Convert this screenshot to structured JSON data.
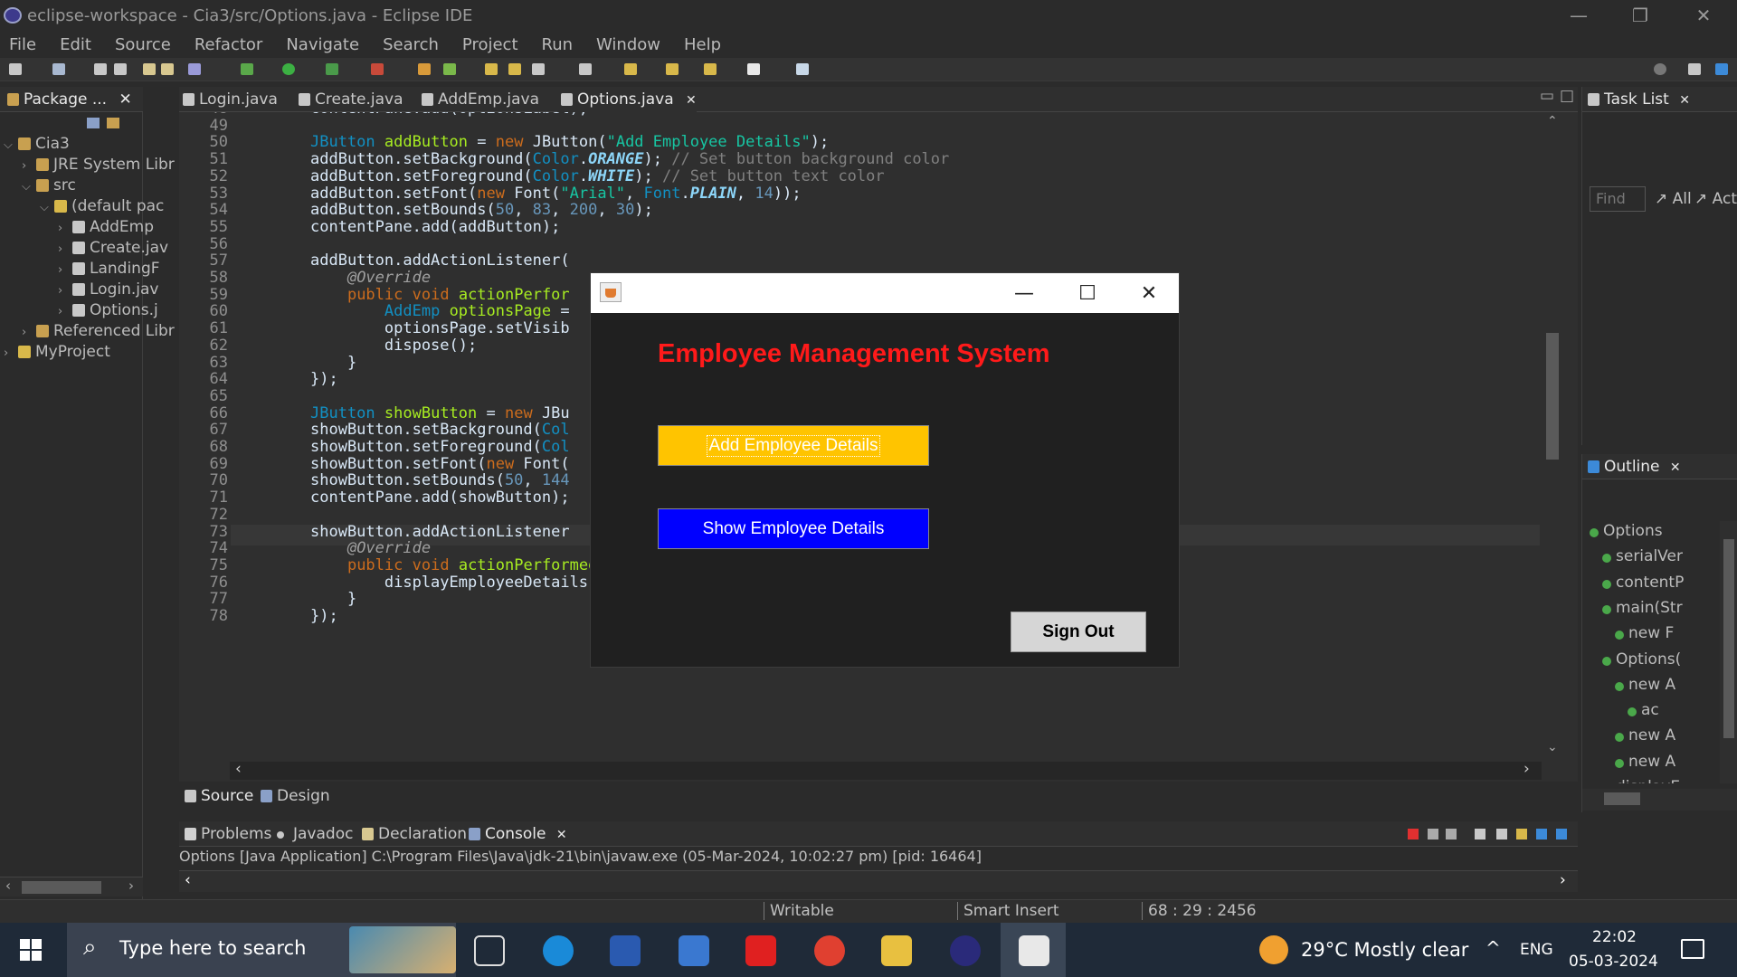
{
  "window": {
    "title": "eclipse-workspace - Cia3/src/Options.java - Eclipse IDE",
    "controls": [
      "—",
      "❐",
      "✕"
    ]
  },
  "menu": [
    "File",
    "Edit",
    "Source",
    "Refactor",
    "Navigate",
    "Search",
    "Project",
    "Run",
    "Window",
    "Help"
  ],
  "package_explorer": {
    "tab_label": "Package ...",
    "rows": [
      {
        "label": "Cia3",
        "arrow": "⌵",
        "indent": 0
      },
      {
        "label": "JRE System Libr",
        "arrow": "›",
        "indent": 1
      },
      {
        "label": "src",
        "arrow": "⌵",
        "indent": 1
      },
      {
        "label": "(default pac",
        "arrow": "⌵",
        "indent": 2
      },
      {
        "label": "AddEmp",
        "arrow": "›",
        "indent": 3
      },
      {
        "label": "Create.jav",
        "arrow": "›",
        "indent": 3
      },
      {
        "label": "LandingF",
        "arrow": "›",
        "indent": 3
      },
      {
        "label": "Login.jav",
        "arrow": "›",
        "indent": 3
      },
      {
        "label": "Options.j",
        "arrow": "›",
        "indent": 3
      },
      {
        "label": "Referenced Libr",
        "arrow": "›",
        "indent": 1
      },
      {
        "label": "MyProject",
        "arrow": "›",
        "indent": 0
      }
    ]
  },
  "editor": {
    "tabs": [
      "Login.java",
      "Create.java",
      "AddEmp.java",
      "Options.java"
    ],
    "active_tab": "Options.java",
    "bottom_tabs": [
      "Source",
      "Design"
    ],
    "lines": [
      {
        "n": "48",
        "html": "contentPane.add(optionsLabel);"
      },
      {
        "n": "49",
        "html": ""
      },
      {
        "n": "50",
        "html": "<span class='ty'>JButton</span> <span class='fn'>addButton</span> = <span class='kw'>new</span> JButton(<span class='st'>\"Add Employee Details\"</span>);"
      },
      {
        "n": "51",
        "html": "addButton.setBackground(<span class='ty'>Color</span>.<span class='sfld'>ORANGE</span>); <span class='cm'>// Set button background color</span>"
      },
      {
        "n": "52",
        "html": "addButton.setForeground(<span class='ty'>Color</span>.<span class='sfld'>WHITE</span>); <span class='cm'>// Set button text color</span>"
      },
      {
        "n": "53",
        "html": "addButton.setFont(<span class='kw'>new</span> Font(<span class='st'>\"Arial\"</span>, <span class='ty'>Font</span>.<span class='sfld'>PLAIN</span>, <span class='nm'>14</span>));"
      },
      {
        "n": "54",
        "html": "addButton.setBounds(<span class='nm'>50</span>, <span class='nm'>83</span>, <span class='nm'>200</span>, <span class='nm'>30</span>);"
      },
      {
        "n": "55",
        "html": "contentPane.add(addButton);"
      },
      {
        "n": "56",
        "html": ""
      },
      {
        "n": "57",
        "html": "addButton.addActionListener("
      },
      {
        "n": "58",
        "html": "    <span class='an'>@Override</span>"
      },
      {
        "n": "59",
        "html": "    <span class='kw'>public</span> <span class='kw'>void</span> <span class='fn'>actionPerfor</span>"
      },
      {
        "n": "60",
        "html": "        <span class='ty'>AddEmp</span> <span class='fn'>optionsPage</span> ="
      },
      {
        "n": "61",
        "html": "        optionsPage.setVisib"
      },
      {
        "n": "62",
        "html": "        dispose();"
      },
      {
        "n": "63",
        "html": "    }"
      },
      {
        "n": "64",
        "html": "});"
      },
      {
        "n": "65",
        "html": ""
      },
      {
        "n": "66",
        "html": "<span class='ty'>JButton</span> <span class='fn'>showButton</span> = <span class='kw'>new</span> JBu"
      },
      {
        "n": "67",
        "html": "showButton.setBackground(<span class='ty'>Col</span>"
      },
      {
        "n": "68",
        "html": "showButton.setForeground(<span class='ty'>Col</span>"
      },
      {
        "n": "69",
        "html": "showButton.setFont(<span class='kw'>new</span> Font("
      },
      {
        "n": "70",
        "html": "showButton.setBounds(<span class='nm'>50</span>, <span class='nm'>144</span>"
      },
      {
        "n": "71",
        "html": "contentPane.add(showButton);"
      },
      {
        "n": "72",
        "html": ""
      },
      {
        "n": "73",
        "html": "showButton.addActionListener"
      },
      {
        "n": "74",
        "html": "    <span class='an'>@Override</span>"
      },
      {
        "n": "75",
        "html": "    <span class='kw'>public</span> <span class='kw'>void</span> <span class='fn'>actionPerformed</span>(<span class='ty'>ActionEvent</span> e) {"
      },
      {
        "n": "76",
        "html": "        displayEmployeeDetails();"
      },
      {
        "n": "77",
        "html": "    }"
      },
      {
        "n": "78",
        "html": "});"
      }
    ]
  },
  "swing_app": {
    "title": "Employee Management System",
    "add_button": "Add Employee Details",
    "show_button": "Show Employee Details",
    "signout_button": "Sign Out",
    "colors": {
      "title": "#ff1a1a",
      "add_bg": "#ffc400",
      "show_bg": "#0000ff",
      "signout_bg": "#d6d6d6"
    }
  },
  "bottom_panel": {
    "tabs": [
      "Problems",
      "Javadoc",
      "Declaration",
      "Console"
    ],
    "active_tab": "Console",
    "console_line": "Options [Java Application] C:\\Program Files\\Java\\jdk-21\\bin\\javaw.exe  (05-Mar-2024, 10:02:27 pm) [pid: 16464]"
  },
  "statusbar": {
    "mode": "Writable",
    "insert": "Smart Insert",
    "position": "68 : 29 : 2456"
  },
  "task_list": {
    "tab_label": "Task List",
    "find_placeholder": "Find",
    "all_label": "All",
    "act_label": "Act"
  },
  "outline": {
    "tab_label": "Outline",
    "rows": [
      "Options",
      "serialVer",
      "contentP",
      "main(Str",
      "new F",
      "Options(",
      "new A",
      "ac",
      "new A",
      "new A",
      "displayE"
    ]
  },
  "taskbar": {
    "search_placeholder": "Type here to search",
    "weather": "29°C  Mostly clear",
    "language": "ENG",
    "time": "22:02",
    "date": "05-03-2024"
  }
}
